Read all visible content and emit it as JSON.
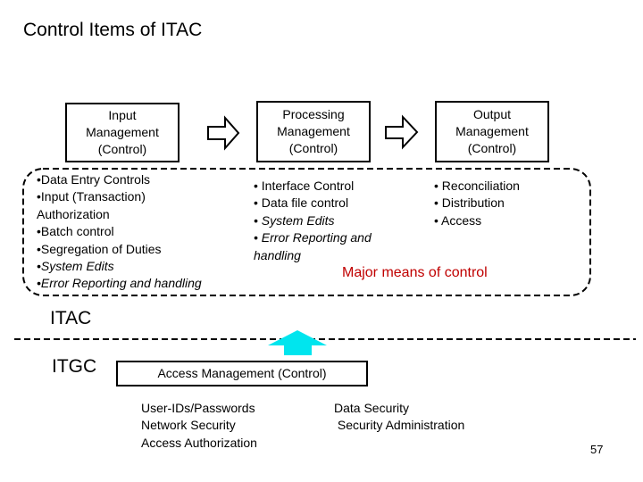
{
  "title": "Control Items of ITAC",
  "stages": {
    "input": "Input\nManagement\n(Control)",
    "processing": "Processing\nManagement\n(Control)",
    "output": "Output\nManagement\n(Control)"
  },
  "lists": {
    "input": [
      {
        "text": "•Data Entry Controls",
        "italic": false
      },
      {
        "text": "•Input (Transaction)",
        "italic": false
      },
      {
        "text": "Authorization",
        "italic": false
      },
      {
        "text": "•Batch control",
        "italic": false
      },
      {
        "text": "•Segregation of Duties",
        "italic": false
      },
      {
        "text": "•System Edits",
        "italic": true
      },
      {
        "text": "•Error Reporting and handling",
        "italic": true
      }
    ],
    "processing": [
      {
        "text": "• Interface Control",
        "italic": false
      },
      {
        "text": "• Data file control",
        "italic": false
      },
      {
        "text": "• System Edits",
        "italic": true
      },
      {
        "text": "• Error Reporting and",
        "italic": true
      },
      {
        "text": "handling",
        "italic": true
      }
    ],
    "output": [
      {
        "text": "• Reconciliation",
        "italic": false
      },
      {
        "text": "• Distribution",
        "italic": false
      },
      {
        "text": "• Access",
        "italic": false
      }
    ]
  },
  "major_means": "Major means of control",
  "major_means_color": "#c00000",
  "layers": {
    "itac": "ITAC",
    "itgc": "ITGC"
  },
  "access_management": {
    "title": "Access Management (Control)",
    "left_items": [
      "User-IDs/Passwords",
      "Network Security",
      "Access Authorization"
    ],
    "right_items": [
      "Data Security",
      " Security Administration"
    ]
  },
  "up_arrow_color": "#00e5ee",
  "page_number": "57"
}
